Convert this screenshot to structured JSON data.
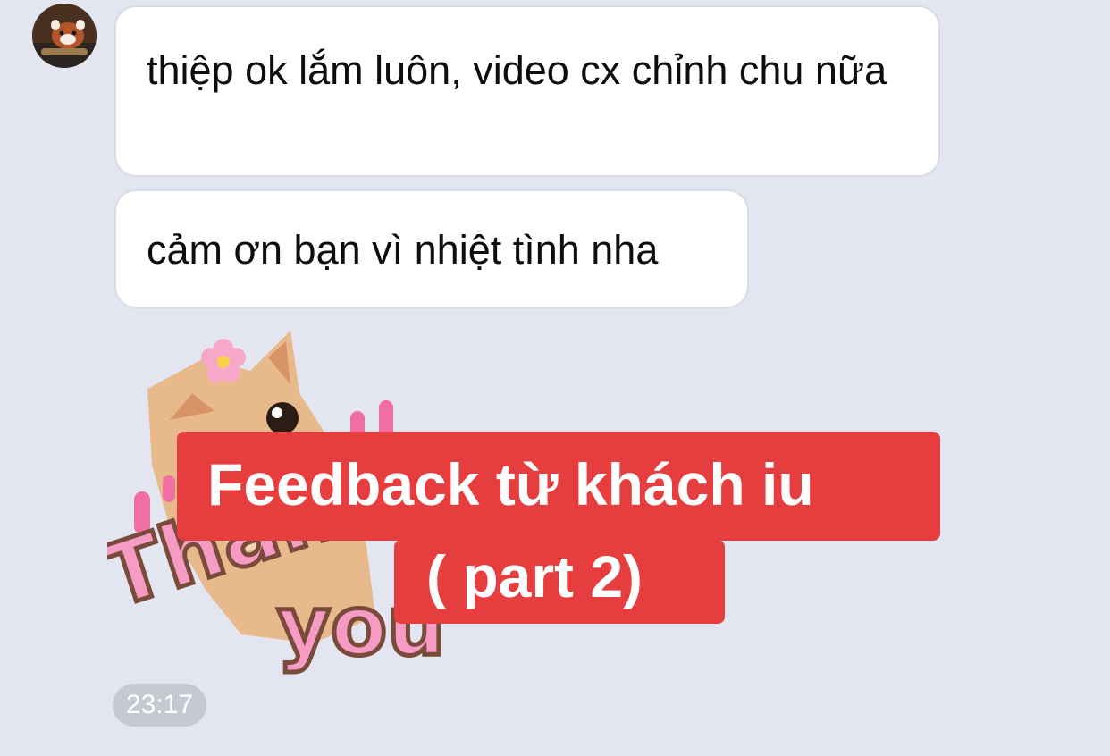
{
  "chat": {
    "avatar_icon": "red-panda-avatar-icon",
    "messages": [
      {
        "text": "thiệp ok lắm luôn, video cx chỉnh chu nữa"
      },
      {
        "text": "cảm ơn bạn vì nhiệt tình nha"
      }
    ],
    "sticker": {
      "icon": "thank-you-cat-sticker",
      "flower_icon": "cherry-blossom-icon"
    },
    "timestamp": "23:17"
  },
  "overlay": {
    "line1": "Feedback từ khách iu",
    "line2": "( part 2)"
  },
  "colors": {
    "background": "#e3e6f0",
    "bubble": "#ffffff",
    "banner": "#e63e3e",
    "sticker_pink": "#f59bc4",
    "timestamp_bg": "#c5c9d1"
  }
}
